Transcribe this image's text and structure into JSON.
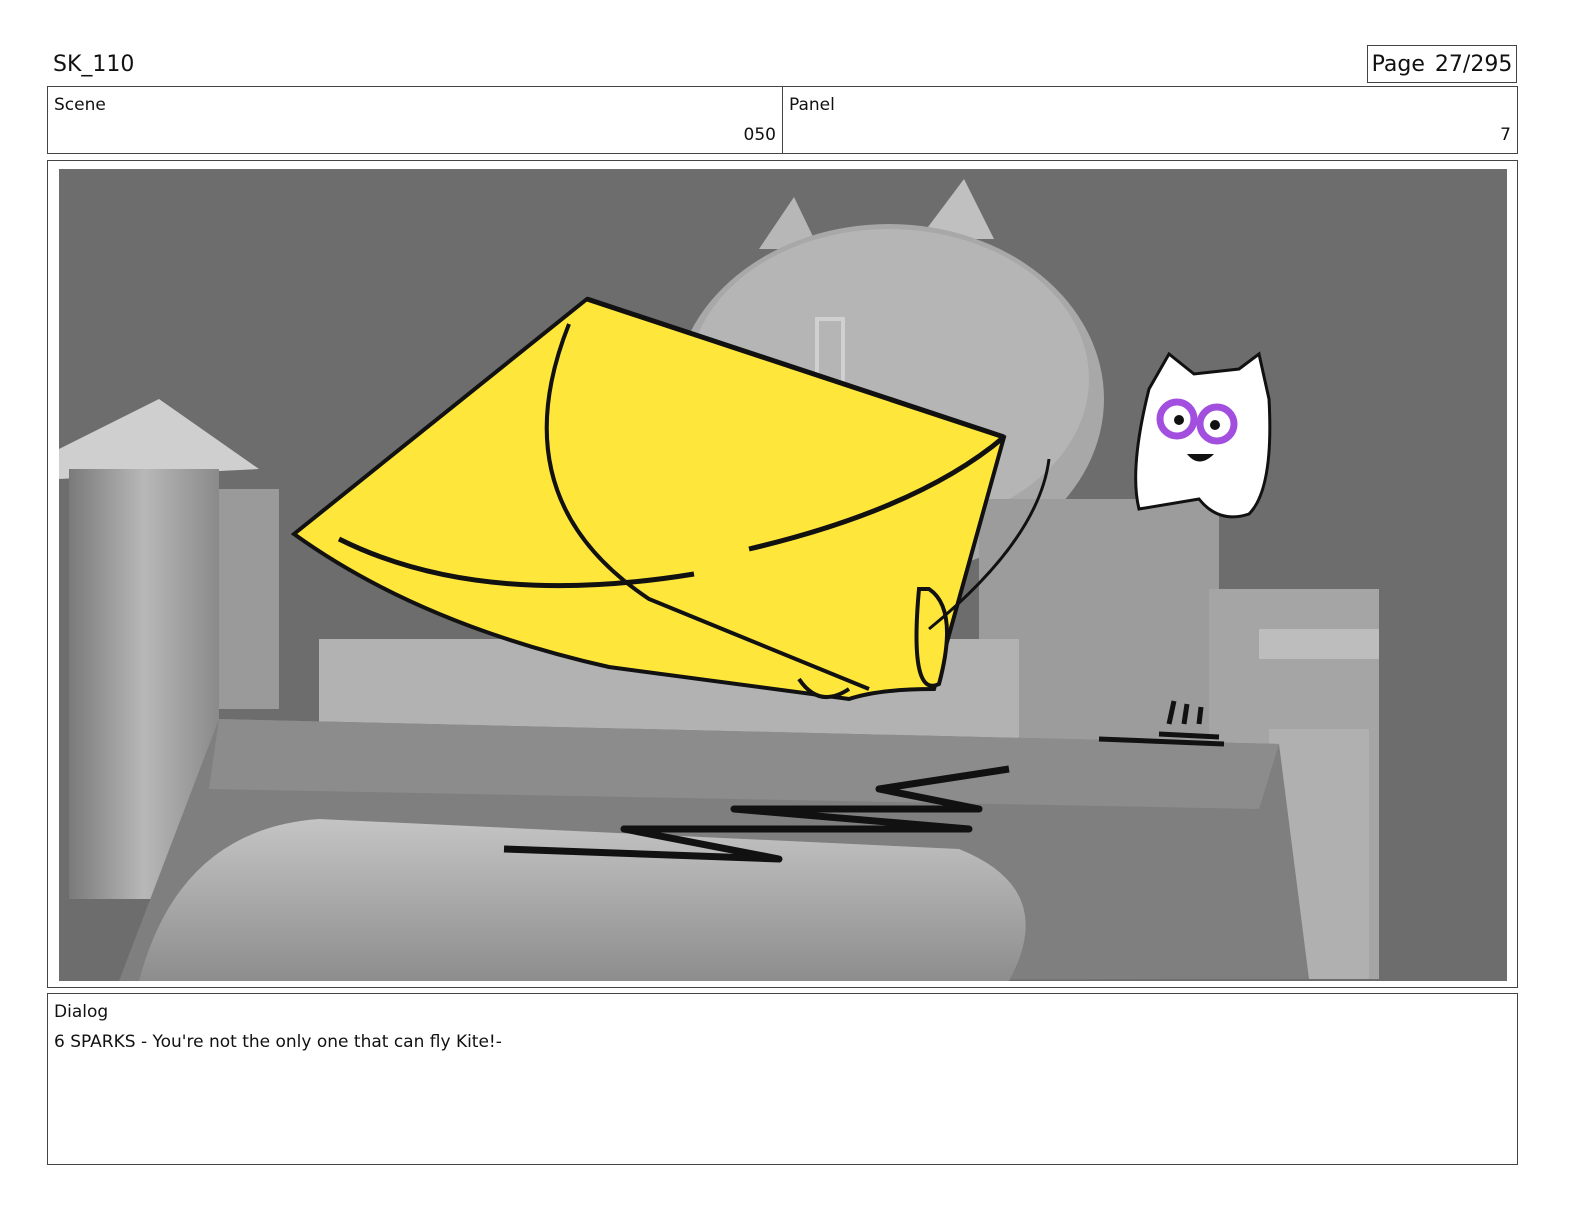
{
  "header": {
    "project": "SK_110",
    "page_label": "Page",
    "page_number": "27/295"
  },
  "scene": {
    "label": "Scene",
    "value": "050"
  },
  "panel": {
    "label": "Panel",
    "value": "7"
  },
  "dialog": {
    "label": "Dialog",
    "text": "6 SPARKS - You're not the only one that can fly Kite!-"
  },
  "colors": {
    "kite": "#ffe63a",
    "background": "#6d6d6d",
    "sparks_eyes": "#a24fe0"
  }
}
